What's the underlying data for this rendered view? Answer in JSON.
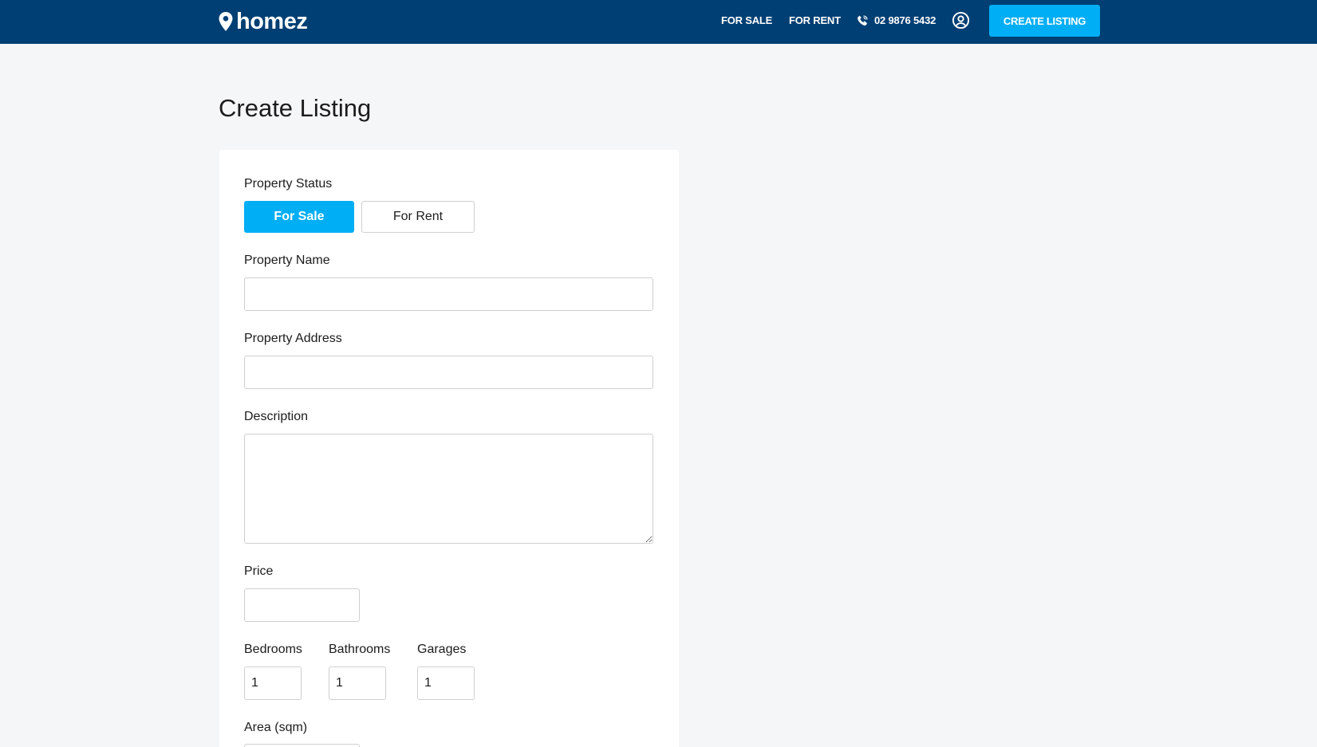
{
  "header": {
    "brand": "homez",
    "nav": {
      "for_sale": "FOR SALE",
      "for_rent": "FOR RENT"
    },
    "phone": "02 9876 5432",
    "create_listing": "CREATE LISTING",
    "colors": {
      "background": "#003f73",
      "accent": "#00aef5"
    }
  },
  "page": {
    "title": "Create Listing"
  },
  "form": {
    "property_status": {
      "label": "Property Status",
      "options": [
        "For Sale",
        "For Rent"
      ],
      "selected": "For Sale"
    },
    "property_name": {
      "label": "Property Name",
      "value": ""
    },
    "property_address": {
      "label": "Property Address",
      "value": ""
    },
    "description": {
      "label": "Description",
      "value": ""
    },
    "price": {
      "label": "Price",
      "value": ""
    },
    "bedrooms": {
      "label": "Bedrooms",
      "value": "1"
    },
    "bathrooms": {
      "label": "Bathrooms",
      "value": "1"
    },
    "garages": {
      "label": "Garages",
      "value": "1"
    },
    "area": {
      "label": "Area (sqm)",
      "value": ""
    }
  },
  "icons": [
    "location-pin-icon",
    "phone-icon",
    "user-account-icon"
  ]
}
